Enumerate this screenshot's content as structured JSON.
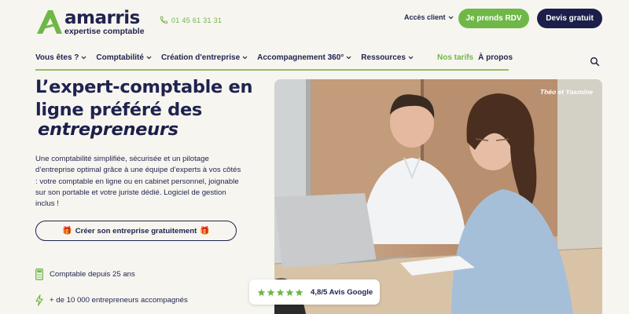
{
  "header": {
    "logo_name": "amarris",
    "logo_tagline": "expertise comptable",
    "phone": "01 45 61 31 31",
    "client_access": "Accès client",
    "cta_rdv": "Je prends RDV",
    "cta_devis": "Devis gratuit"
  },
  "nav": {
    "items": [
      {
        "label": "Vous êtes ?"
      },
      {
        "label": "Comptabilité"
      },
      {
        "label": "Création d'entreprise"
      },
      {
        "label": "Accompagnement 360°"
      },
      {
        "label": "Ressources"
      }
    ],
    "tarifs": "Nos tarifs",
    "apropos": "À propos"
  },
  "hero": {
    "title": "L’expert-comptable en ligne préféré des",
    "title_em": "entrepreneurs",
    "description": "Une comptabilité simplifiée, sécurisée et un pilotage d’entreprise optimal grâce à une équipe d’experts à vos côtés : votre comptable en ligne ou en cabinet personnel, joignable sur son portable et votre juriste dédié. Logiciel de gestion inclus !",
    "cta_create": "Créer son entreprise gratuitement",
    "features": [
      {
        "text": "Comptable depuis 25 ans",
        "icon": "calculator-icon"
      },
      {
        "text": "+ de 10 000 entrepreneurs accompagnés",
        "icon": "lightning-icon"
      }
    ]
  },
  "photo": {
    "caption": "Théo et Yasmine",
    "rating": "4,8/5 Avis Google",
    "stars": 5
  },
  "colors": {
    "navy": "#1f2350",
    "green": "#6fb848",
    "background": "#f7f5ef"
  }
}
